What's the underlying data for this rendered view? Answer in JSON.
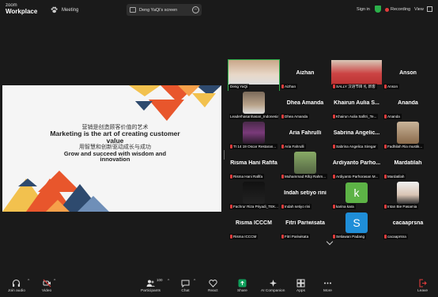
{
  "app": {
    "brand_line1": "zoom",
    "brand_line2": "Workplace",
    "meeting_label": "Meeting"
  },
  "screen_share": {
    "label": "Deng YaQi's screen"
  },
  "header_right": {
    "sign_in": "Sign in",
    "recording": "Recording",
    "view": "View"
  },
  "slide": {
    "line1_cn": "营销是创造顾客价值的艺术",
    "line2_en": "Marketing is the art of creating customer value",
    "line3_cn": "用智慧和创新驱动成长与成功",
    "line4_en": "Grow and succeed with wisdom and innovation"
  },
  "gallery": {
    "tiles": [
      {
        "name": "",
        "label": "Deng YaQi",
        "muted": false,
        "kind": "video"
      },
      {
        "name": "Aizhan",
        "label": "Aizhan",
        "muted": true,
        "kind": "name"
      },
      {
        "name": "",
        "label": "SALLY 汉语节目 扎 新客",
        "muted": true,
        "kind": "video"
      },
      {
        "name": "Anson",
        "label": "Anson",
        "muted": true,
        "kind": "name"
      },
      {
        "name": "",
        "label": "Leaderhasanhasan_Indonesian",
        "muted": false,
        "kind": "video"
      },
      {
        "name": "Dhea Amanda",
        "label": "Dhea Amanda",
        "muted": true,
        "kind": "name"
      },
      {
        "name": "Khairun Aulia S...",
        "label": "Khairun Aulia Safitri_Te...",
        "muted": true,
        "kind": "name"
      },
      {
        "name": "Ananda",
        "label": "Ananda",
        "muted": true,
        "kind": "name"
      },
      {
        "name": "",
        "label": "TI 14 19 Oscar Restaran...",
        "muted": true,
        "kind": "video"
      },
      {
        "name": "Aria Fahrulli",
        "label": "Aria Fahrulli",
        "muted": true,
        "kind": "name"
      },
      {
        "name": "Sabrina Angelic...",
        "label": "Sabrina Angelica Siregar",
        "muted": true,
        "kind": "name"
      },
      {
        "name": "",
        "label": "Fadhilah Ria mustik...",
        "muted": true,
        "kind": "video"
      },
      {
        "name": "Risma Hani Rafifa",
        "label": "Risma Hani Rafifa",
        "muted": true,
        "kind": "name"
      },
      {
        "name": "",
        "label": "Muhammad Rifqi Rahm...",
        "muted": true,
        "kind": "video"
      },
      {
        "name": "Ardiyanto Parho...",
        "label": "Ardiyanto Parhorasan M...",
        "muted": true,
        "kind": "name"
      },
      {
        "name": "Mardatilah",
        "label": "Mardatilah",
        "muted": true,
        "kind": "name"
      },
      {
        "name": "",
        "label": "Fachrur Riza Priyadi_TEK...",
        "muted": true,
        "kind": "video"
      },
      {
        "name": "Indah setiyo rini",
        "label": "Indah setiyo rini",
        "muted": true,
        "kind": "name"
      },
      {
        "name": "",
        "label": "karina kara",
        "muted": true,
        "kind": "letter",
        "letter": "k"
      },
      {
        "name": "",
        "label": "Intan Bie Pasamia",
        "muted": true,
        "kind": "video"
      },
      {
        "name": "Risma ICCCM",
        "label": "Risma ICCCM",
        "muted": true,
        "kind": "name"
      },
      {
        "name": "Fitri Pariwisata",
        "label": "Fitri Pariwisata",
        "muted": true,
        "kind": "name"
      },
      {
        "name": "",
        "label": "Setiawan Padang",
        "muted": true,
        "kind": "letter",
        "letter": "S"
      },
      {
        "name": "cacaaprsna",
        "label": "cacaaprsna",
        "muted": true,
        "kind": "name"
      }
    ]
  },
  "toolbar": {
    "join_audio": "Join audio",
    "video": "Video",
    "participants": "Participants",
    "participants_count": "100",
    "chat": "Chat",
    "react": "React",
    "share": "Share",
    "ai_companion": "AI Companion",
    "apps": "Apps",
    "more": "More",
    "leave": "Leave"
  },
  "colors": {
    "accent_green": "#2bb04a",
    "mute_red": "#e03c3c",
    "share_green": "#0e9f5b",
    "letter_k": "#5db346",
    "letter_s": "#1f8ed8",
    "slide_orange": "#e8562c",
    "slide_navy": "#2e4a6e",
    "slide_yellow": "#f2c14e"
  }
}
